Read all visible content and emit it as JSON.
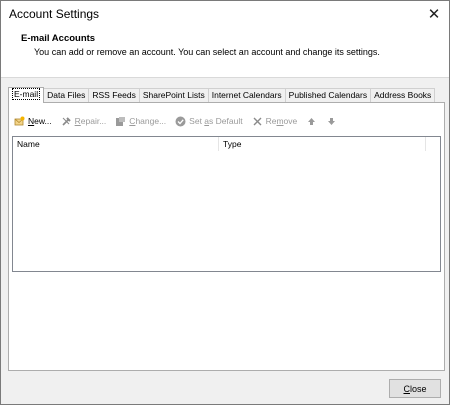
{
  "window": {
    "title": "Account Settings"
  },
  "header": {
    "heading": "E-mail Accounts",
    "description": "You can add or remove an account. You can select an account and change its settings."
  },
  "tabs": [
    {
      "label": "E-mail",
      "active": true
    },
    {
      "label": "Data Files"
    },
    {
      "label": "RSS Feeds"
    },
    {
      "label": "SharePoint Lists"
    },
    {
      "label": "Internet Calendars"
    },
    {
      "label": "Published Calendars"
    },
    {
      "label": "Address Books"
    }
  ],
  "toolbar": {
    "new": {
      "label": "New...",
      "icon": "new-account-icon",
      "enabled": true
    },
    "repair": {
      "label": "Repair...",
      "icon": "repair-icon",
      "enabled": false
    },
    "change": {
      "label": "Change...",
      "icon": "change-icon",
      "enabled": false
    },
    "set_default": {
      "label": "Set as Default",
      "icon": "checkmark-icon",
      "enabled": false
    },
    "remove": {
      "label": "Remove",
      "icon": "remove-icon",
      "enabled": false
    },
    "move_up": {
      "icon": "arrow-up-icon",
      "enabled": false
    },
    "move_down": {
      "icon": "arrow-down-icon",
      "enabled": false
    }
  },
  "list": {
    "columns": [
      "Name",
      "Type"
    ],
    "rows": []
  },
  "footer": {
    "close_label": "Close"
  },
  "colors": {
    "dialog_bg": "#f0f0f0",
    "disabled_text": "#9a9a9a",
    "border": "#adadad"
  }
}
